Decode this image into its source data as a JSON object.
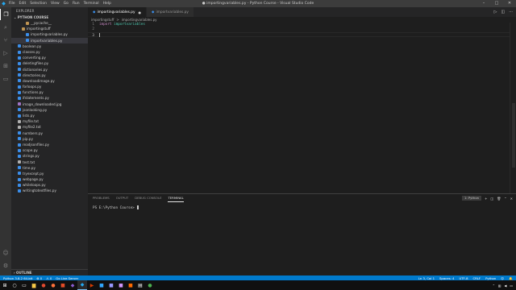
{
  "titlebar": {
    "menu": [
      "File",
      "Edit",
      "Selection",
      "View",
      "Go",
      "Run",
      "Terminal",
      "Help"
    ],
    "title": "● importingvariables.py - Python Course - Visual Studio Code",
    "controls": [
      "–",
      "□",
      "✕"
    ]
  },
  "sidebar": {
    "header": "EXPLORER",
    "section": "PYTHON COURSE",
    "items": [
      {
        "label": "__pycache__",
        "indent": 2,
        "type": "folder"
      },
      {
        "label": "importingstuff",
        "indent": 1,
        "type": "folder"
      },
      {
        "label": "importingvariables.py",
        "indent": 2,
        "type": "py"
      },
      {
        "label": "importvariables.py",
        "indent": 2,
        "type": "py",
        "selected": true
      },
      {
        "label": "boolean.py",
        "indent": 0,
        "type": "py"
      },
      {
        "label": "classes.py",
        "indent": 0,
        "type": "py"
      },
      {
        "label": "converting.py",
        "indent": 0,
        "type": "py"
      },
      {
        "label": "deletingfiles.py",
        "indent": 0,
        "type": "py"
      },
      {
        "label": "dictionaries.py",
        "indent": 0,
        "type": "py"
      },
      {
        "label": "directories.py",
        "indent": 0,
        "type": "py"
      },
      {
        "label": "downloadimage.py",
        "indent": 0,
        "type": "py"
      },
      {
        "label": "forloops.py",
        "indent": 0,
        "type": "py"
      },
      {
        "label": "functions.py",
        "indent": 0,
        "type": "py"
      },
      {
        "label": "ifstatements.py",
        "indent": 0,
        "type": "py"
      },
      {
        "label": "image_downloaded.jpg",
        "indent": 0,
        "type": "img"
      },
      {
        "label": "jsonlooking.py",
        "indent": 0,
        "type": "py"
      },
      {
        "label": "lists.py",
        "indent": 0,
        "type": "py"
      },
      {
        "label": "myfile.txt",
        "indent": 0,
        "type": "txt"
      },
      {
        "label": "myfile2.txt",
        "indent": 0,
        "type": "txt"
      },
      {
        "label": "numbers.py",
        "indent": 0,
        "type": "py"
      },
      {
        "label": "pip.py",
        "indent": 0,
        "type": "py"
      },
      {
        "label": "readjsonfiles.py",
        "indent": 0,
        "type": "py"
      },
      {
        "label": "scope.py",
        "indent": 0,
        "type": "py"
      },
      {
        "label": "strings.py",
        "indent": 0,
        "type": "py"
      },
      {
        "label": "test.txt",
        "indent": 0,
        "type": "txt"
      },
      {
        "label": "time.py",
        "indent": 0,
        "type": "py"
      },
      {
        "label": "tryexcept.py",
        "indent": 0,
        "type": "py"
      },
      {
        "label": "webpage.py",
        "indent": 0,
        "type": "py"
      },
      {
        "label": "whileloops.py",
        "indent": 0,
        "type": "py"
      },
      {
        "label": "writingtotextfiles.py",
        "indent": 0,
        "type": "py"
      }
    ],
    "outline": "OUTLINE"
  },
  "tabs": [
    {
      "label": "importingvariables.py",
      "active": true,
      "close": "●"
    },
    {
      "label": "importvariables.py",
      "active": false,
      "close": ""
    }
  ],
  "breadcrumb": [
    "importingstuff",
    ">",
    "importingvariables.py"
  ],
  "editor": {
    "lines": [
      {
        "num": "1",
        "keyword": "import",
        "module": "importvariables"
      },
      {
        "num": "2",
        "keyword": "",
        "module": ""
      },
      {
        "num": "3",
        "keyword": "",
        "module": ""
      }
    ]
  },
  "panel": {
    "tabs": [
      "PROBLEMS",
      "OUTPUT",
      "DEBUG CONSOLE",
      "TERMINAL"
    ],
    "active_tab": "TERMINAL",
    "terminal_selector": "1: Python",
    "prompt": "PS E:\\Python Course> "
  },
  "statusbar": {
    "interpreter": "Python 3.8.2 64-bit",
    "errors": "⊗ 0",
    "warnings": "⚠ 0",
    "live_server": "Go Live Server",
    "position": "Ln 3, Col 1",
    "spaces": "Spaces: 4",
    "encoding": "UTF-8",
    "eol": "CRLF",
    "language": "Python"
  },
  "colors": {
    "accent": "#007acc",
    "keyword": "#c586c0",
    "module": "#4ec9b0"
  }
}
